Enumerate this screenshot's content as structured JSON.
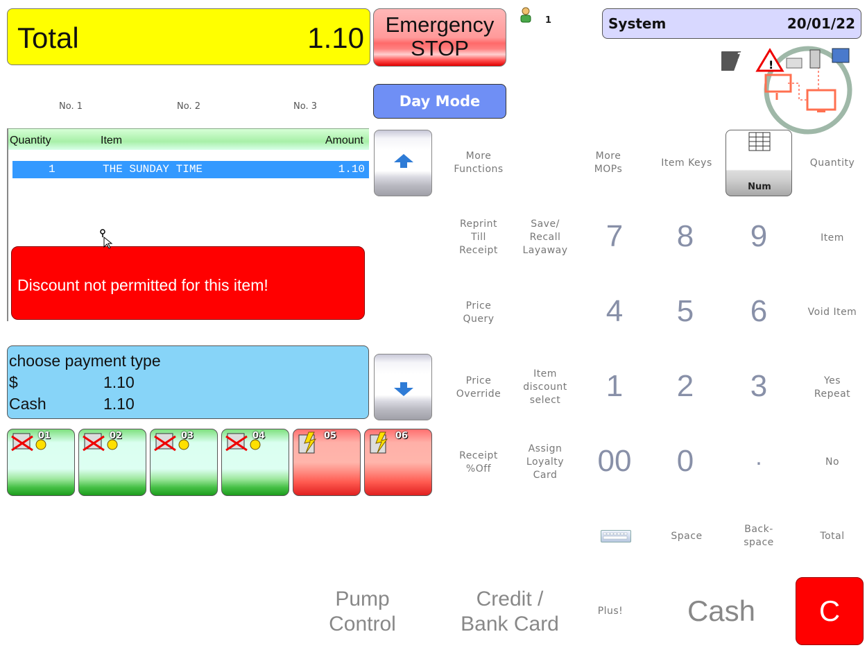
{
  "total": {
    "label": "Total",
    "value": "1.10"
  },
  "emergency": {
    "line1": "Emergency",
    "line2": "STOP"
  },
  "operator": {
    "count": "1"
  },
  "system": {
    "label": "System",
    "date": "20/01/22"
  },
  "status": {
    "badge": "1"
  },
  "day_mode": "Day Mode",
  "tabs": [
    "No. 1",
    "No. 2",
    "No. 3"
  ],
  "list": {
    "headers": {
      "quantity": "Quantity",
      "item": "Item",
      "amount": "Amount"
    },
    "rows": [
      {
        "qty": "1",
        "item": "THE SUNDAY TIME",
        "amount": "1.10"
      }
    ]
  },
  "error": "Discount not permitted for this item!",
  "payment": {
    "prompt": "choose payment type",
    "lines": [
      {
        "label": "$",
        "value": "1.10"
      },
      {
        "label": "Cash",
        "value": "1.10"
      }
    ]
  },
  "pumps": [
    {
      "num": "01",
      "state": "green"
    },
    {
      "num": "02",
      "state": "green"
    },
    {
      "num": "03",
      "state": "green"
    },
    {
      "num": "04",
      "state": "green"
    },
    {
      "num": "05",
      "state": "red"
    },
    {
      "num": "06",
      "state": "red"
    }
  ],
  "functions": {
    "more_functions": [
      "More",
      "Functions"
    ],
    "more_mops": [
      "More",
      "MOPs"
    ],
    "item_keys": "Item Keys",
    "num": "Num",
    "quantity": "Quantity",
    "reprint": [
      "Reprint",
      "Till",
      "Receipt"
    ],
    "save_recall": [
      "Save/",
      "Recall",
      "Layaway"
    ],
    "item": "Item",
    "price_query": [
      "Price",
      "Query"
    ],
    "void_item": "Void Item",
    "price_override": [
      "Price",
      "Override"
    ],
    "item_discount": [
      "Item",
      "discount",
      "select"
    ],
    "yes_repeat": [
      "Yes",
      "Repeat"
    ],
    "receipt_off": [
      "Receipt",
      "%Off"
    ],
    "assign_loyalty": [
      "Assign",
      "Loyalty",
      "Card"
    ],
    "no": "No",
    "space": "Space",
    "backspace": [
      "Back-",
      "space"
    ],
    "total_key": "Total",
    "pump_control": [
      "Pump",
      "Control"
    ],
    "credit_card": [
      "Credit /",
      "Bank Card"
    ],
    "plus": "Plus!",
    "cash": "Cash",
    "clear": "C"
  },
  "keypad": {
    "row1": [
      "7",
      "8",
      "9"
    ],
    "row2": [
      "4",
      "5",
      "6"
    ],
    "row3": [
      "1",
      "2",
      "3"
    ],
    "row4": [
      "00",
      "0",
      "."
    ]
  },
  "colors": {
    "total_bg": "#ffff00",
    "error_bg": "#ff0000",
    "payment_bg": "#87d4f8",
    "day_mode_bg": "#6f8ff5",
    "selected_row": "#3399ff"
  }
}
